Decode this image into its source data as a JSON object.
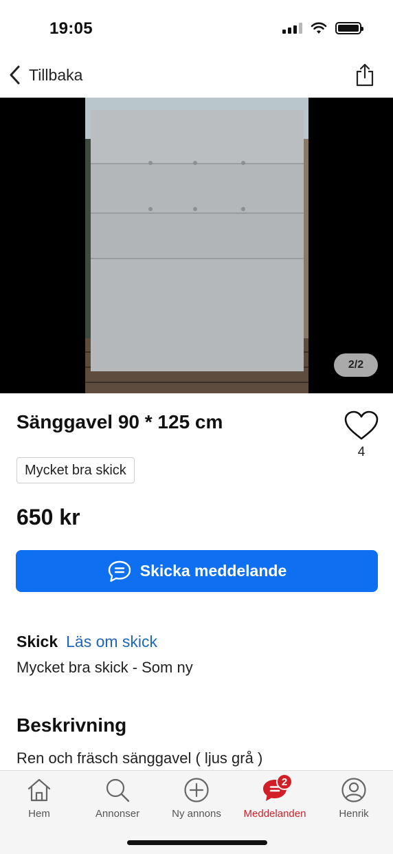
{
  "status_bar": {
    "time": "19:05"
  },
  "nav": {
    "back_label": "Tillbaka"
  },
  "gallery": {
    "counter": "2/2"
  },
  "listing": {
    "title": "Sänggavel 90 * 125 cm",
    "favorites_count": "4",
    "condition_chip": "Mycket bra skick",
    "price": "650 kr",
    "message_button": "Skicka meddelande"
  },
  "condition": {
    "label": "Skick",
    "link": "Läs om skick",
    "value": "Mycket bra skick - Som ny"
  },
  "description": {
    "heading": "Beskrivning",
    "text": "Ren och fräsch sänggavel ( ljus grå )"
  },
  "tabs": [
    {
      "label": "Hem",
      "icon": "home-icon"
    },
    {
      "label": "Annonser",
      "icon": "search-icon"
    },
    {
      "label": "Ny annons",
      "icon": "plus-circle-icon"
    },
    {
      "label": "Meddelanden",
      "icon": "chat-icon",
      "badge": "2",
      "active": true
    },
    {
      "label": "Henrik",
      "icon": "profile-icon"
    }
  ],
  "colors": {
    "primary": "#0e6ff0",
    "accent_red": "#d01f27",
    "link": "#1f66b8"
  }
}
